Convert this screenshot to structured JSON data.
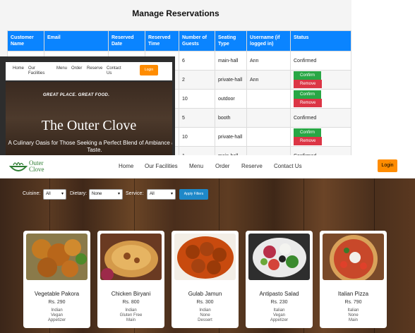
{
  "admin": {
    "title": "Manage Reservations",
    "columns": [
      "Customer Name",
      "Email",
      "Reserved Date",
      "Reserved Time",
      "Number of Guests",
      "Seating Type",
      "Username (if logged in)",
      "Status"
    ],
    "rows": [
      {
        "guests": "6",
        "seating": "main-hall",
        "username": "Ann",
        "status": "Confirmed",
        "actions": false
      },
      {
        "guests": "2",
        "seating": "private-hall",
        "username": "Ann",
        "status": "",
        "actions": true
      },
      {
        "guests": "10",
        "seating": "outdoor",
        "username": "",
        "status": "",
        "actions": true
      },
      {
        "guests": "5",
        "seating": "booth",
        "username": "",
        "status": "Confirmed",
        "actions": false
      },
      {
        "guests": "10",
        "seating": "private-hall",
        "username": "",
        "status": "",
        "actions": true
      },
      {
        "guests": "1",
        "seating": "main-hall",
        "username": "",
        "status": "Confirmed",
        "actions": false
      }
    ],
    "first_name_partial": "Ann",
    "confirm_label": "Confirm",
    "remove_label": "Remove"
  },
  "mini": {
    "nav": [
      "Home",
      "Our Facilities",
      "Menu",
      "Order",
      "Reserve",
      "Contact Us"
    ],
    "login": "Login",
    "tagline": "GREAT PLACE. GREAT FOOD.",
    "hero_title": "The Outer Clove",
    "hero_sub": "A Culinary Oasis for Those Seeking a Perfect Blend of Ambiance and Taste."
  },
  "site": {
    "logo_line1": "Outer",
    "logo_line2": "Clove",
    "nav": [
      "Home",
      "Our Facilities",
      "Menu",
      "Order",
      "Reserve",
      "Contact Us"
    ],
    "login": "Login",
    "filters": {
      "cuisine_label": "Cuisine:",
      "cuisine_value": "All",
      "dietary_label": "Dietary:",
      "dietary_value": "None",
      "service_label": "Service:",
      "service_value": "All",
      "apply_label": "Apply Filters"
    },
    "items": [
      {
        "name": "Vegetable Pakora",
        "price": "Rs. 290",
        "cuisine": "Indian",
        "dietary": "Vegan",
        "service": "Appetizer"
      },
      {
        "name": "Chicken Biryani",
        "price": "Rs. 800",
        "cuisine": "Indian",
        "dietary": "Gluten Free",
        "service": "Main"
      },
      {
        "name": "Gulab Jamun",
        "price": "Rs. 300",
        "cuisine": "Indian",
        "dietary": "None",
        "service": "Dessert"
      },
      {
        "name": "Antipasto Salad",
        "price": "Rs. 230",
        "cuisine": "Italian",
        "dietary": "Vegan",
        "service": "Appetizer"
      },
      {
        "name": "Italian Pizza",
        "price": "Rs. 790",
        "cuisine": "Italian",
        "dietary": "None",
        "service": "Main"
      }
    ]
  },
  "colors": {
    "table_header": "#0a84ff",
    "confirm": "#28a745",
    "remove": "#dc3545",
    "login": "#ff8c00",
    "apply": "#1e88c8",
    "logo_green": "#2e7d32"
  }
}
